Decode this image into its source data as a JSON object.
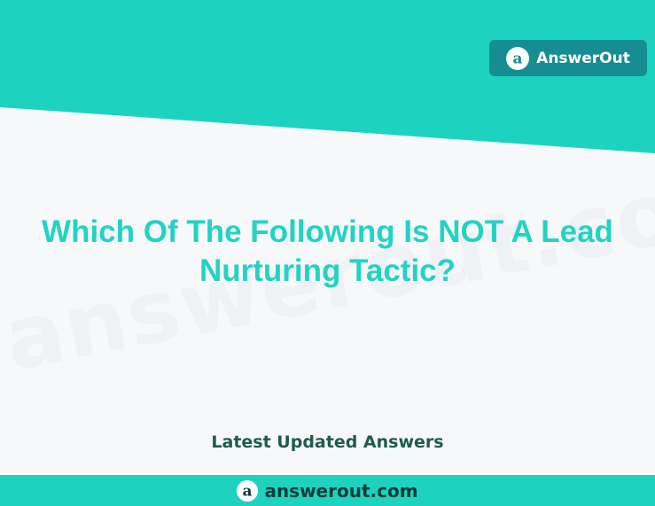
{
  "brand": {
    "name": "AnswerOut",
    "logo_icon": "a-circle-logo-icon"
  },
  "question": {
    "title": "Which Of The Following Is NOT A Lead Nurturing Tactic?"
  },
  "watermark": {
    "text": "answerout.com"
  },
  "section": {
    "latest_label": "Latest Updated Answers"
  },
  "footer": {
    "domain": "answerout.com"
  },
  "colors": {
    "band_teal": "#1ed2c0",
    "badge_teal": "#158d92",
    "title_teal": "#22d3c4",
    "latest_text": "#1f5a4f",
    "footer_text": "#0b3d38",
    "page_bg": "#f7f8fa"
  }
}
